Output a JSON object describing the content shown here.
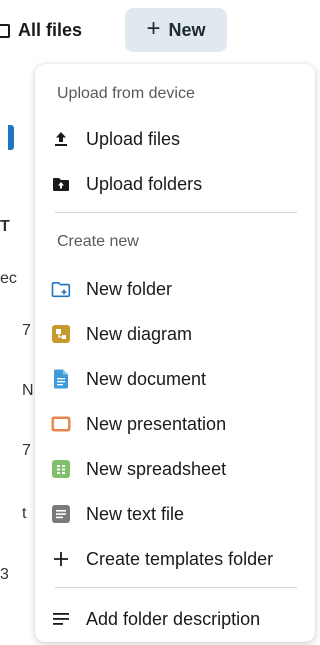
{
  "header": {
    "all_files_label": "All files",
    "new_button_label": "New",
    "new_button_icon": "plus-icon"
  },
  "background": {
    "fragments": [
      "T",
      "ec",
      "7",
      "N",
      "7",
      "t",
      "3"
    ]
  },
  "menu": {
    "upload_caption": "Upload from device",
    "upload_items": [
      {
        "label": "Upload files",
        "icon": "upload-icon"
      },
      {
        "label": "Upload folders",
        "icon": "upload-folder-icon"
      }
    ],
    "create_caption": "Create new",
    "create_items": [
      {
        "label": "New folder",
        "icon": "new-folder-icon",
        "color": "#1f75c0"
      },
      {
        "label": "New diagram",
        "icon": "diagram-icon",
        "color": "#c79a2e"
      },
      {
        "label": "New document",
        "icon": "document-icon",
        "color": "#3d9bdc"
      },
      {
        "label": "New presentation",
        "icon": "presentation-icon",
        "color": "#e8874f"
      },
      {
        "label": "New spreadsheet",
        "icon": "spreadsheet-icon",
        "color": "#82c06b"
      },
      {
        "label": "New text file",
        "icon": "text-file-icon",
        "color": "#7a7a7a"
      },
      {
        "label": "Create templates folder",
        "icon": "plus-icon",
        "color": "#1a1a1a"
      }
    ],
    "extra_items": [
      {
        "label": "Add folder description",
        "icon": "description-icon"
      }
    ]
  }
}
